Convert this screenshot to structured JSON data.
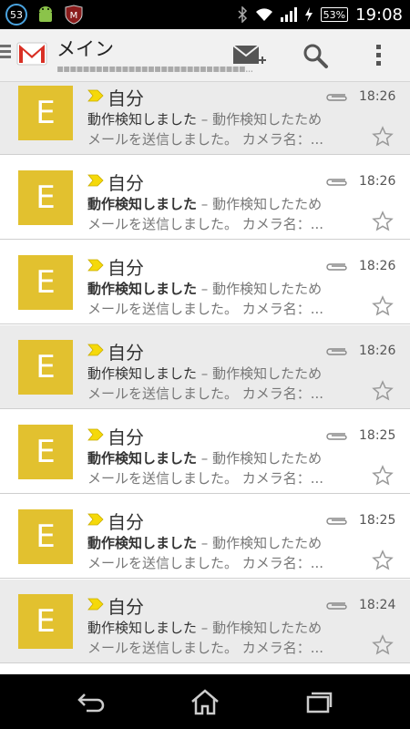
{
  "status_bar": {
    "notification_count": "53",
    "battery": "53%",
    "time": "19:08"
  },
  "action_bar": {
    "title": "メイン",
    "account": "▪▪▪▪▪▪▪▪▪▪▪▪▪▪▪▪▪▪▪▪▪▪▪▪▪▪▪▪▪..."
  },
  "emails": [
    {
      "initial": "E",
      "sender": "自分",
      "subject": "動作検知しました",
      "separator": " – ",
      "snippet1": "動作検知したため",
      "snippet2": "メールを送信しました。 カメラ名：...",
      "time": "18:26",
      "read": true
    },
    {
      "initial": "E",
      "sender": "自分",
      "subject": "動作検知しました",
      "separator": " – ",
      "snippet1": "動作検知したため",
      "snippet2": "メールを送信しました。 カメラ名：...",
      "time": "18:26",
      "read": false
    },
    {
      "initial": "E",
      "sender": "自分",
      "subject": "動作検知しました",
      "separator": " – ",
      "snippet1": "動作検知したため",
      "snippet2": "メールを送信しました。 カメラ名：...",
      "time": "18:26",
      "read": false
    },
    {
      "initial": "E",
      "sender": "自分",
      "subject": "動作検知しました",
      "separator": " – ",
      "snippet1": "動作検知したため",
      "snippet2": "メールを送信しました。 カメラ名：...",
      "time": "18:26",
      "read": true
    },
    {
      "initial": "E",
      "sender": "自分",
      "subject": "動作検知しました",
      "separator": " – ",
      "snippet1": "動作検知したため",
      "snippet2": "メールを送信しました。 カメラ名：...",
      "time": "18:25",
      "read": false
    },
    {
      "initial": "E",
      "sender": "自分",
      "subject": "動作検知しました",
      "separator": " – ",
      "snippet1": "動作検知したため",
      "snippet2": "メールを送信しました。 カメラ名：...",
      "time": "18:25",
      "read": false
    },
    {
      "initial": "E",
      "sender": "自分",
      "subject": "動作検知しました",
      "separator": " – ",
      "snippet1": "動作検知したため",
      "snippet2": "メールを送信しました。 カメラ名：...",
      "time": "18:24",
      "read": true
    }
  ],
  "colors": {
    "avatar": "#e2c12f",
    "importance_marker": "#f5d90a",
    "gmail_red": "#d93025"
  }
}
